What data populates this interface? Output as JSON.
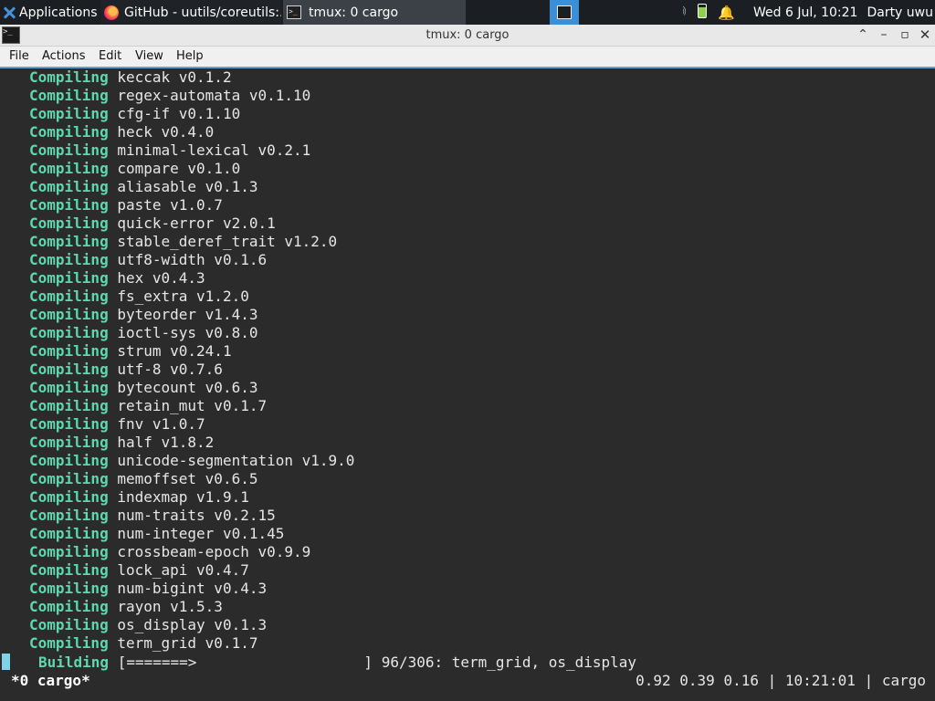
{
  "panel": {
    "applications_label": "Applications",
    "tasks": [
      {
        "title": "GitHub - uutils/coreutils:...",
        "icon": "firefox-icon"
      },
      {
        "title": "tmux: 0 cargo",
        "icon": "terminal-icon"
      }
    ],
    "tray": {
      "volume_icon": "🔊",
      "notification_icon": "🔔",
      "clock": "Wed  6 Jul, 10:21",
      "user": "Darty uwu"
    }
  },
  "window": {
    "title": "tmux: 0 cargo",
    "controls": {
      "shade": "⌃",
      "minimize": "–",
      "maximize": "▫",
      "close": "✕"
    }
  },
  "menubar": {
    "file": "File",
    "actions": "Actions",
    "edit": "Edit",
    "view": "View",
    "help": "Help"
  },
  "terminal": {
    "lines": [
      {
        "verb": "Compiling",
        "text": "keccak v0.1.2"
      },
      {
        "verb": "Compiling",
        "text": "regex-automata v0.1.10"
      },
      {
        "verb": "Compiling",
        "text": "cfg-if v0.1.10"
      },
      {
        "verb": "Compiling",
        "text": "heck v0.4.0"
      },
      {
        "verb": "Compiling",
        "text": "minimal-lexical v0.2.1"
      },
      {
        "verb": "Compiling",
        "text": "compare v0.1.0"
      },
      {
        "verb": "Compiling",
        "text": "aliasable v0.1.3"
      },
      {
        "verb": "Compiling",
        "text": "paste v1.0.7"
      },
      {
        "verb": "Compiling",
        "text": "quick-error v2.0.1"
      },
      {
        "verb": "Compiling",
        "text": "stable_deref_trait v1.2.0"
      },
      {
        "verb": "Compiling",
        "text": "utf8-width v0.1.6"
      },
      {
        "verb": "Compiling",
        "text": "hex v0.4.3"
      },
      {
        "verb": "Compiling",
        "text": "fs_extra v1.2.0"
      },
      {
        "verb": "Compiling",
        "text": "byteorder v1.4.3"
      },
      {
        "verb": "Compiling",
        "text": "ioctl-sys v0.8.0"
      },
      {
        "verb": "Compiling",
        "text": "strum v0.24.1"
      },
      {
        "verb": "Compiling",
        "text": "utf-8 v0.7.6"
      },
      {
        "verb": "Compiling",
        "text": "bytecount v0.6.3"
      },
      {
        "verb": "Compiling",
        "text": "retain_mut v0.1.7"
      },
      {
        "verb": "Compiling",
        "text": "fnv v1.0.7"
      },
      {
        "verb": "Compiling",
        "text": "half v1.8.2"
      },
      {
        "verb": "Compiling",
        "text": "unicode-segmentation v1.9.0"
      },
      {
        "verb": "Compiling",
        "text": "memoffset v0.6.5"
      },
      {
        "verb": "Compiling",
        "text": "indexmap v1.9.1"
      },
      {
        "verb": "Compiling",
        "text": "num-traits v0.2.15"
      },
      {
        "verb": "Compiling",
        "text": "num-integer v0.1.45"
      },
      {
        "verb": "Compiling",
        "text": "crossbeam-epoch v0.9.9"
      },
      {
        "verb": "Compiling",
        "text": "lock_api v0.4.7"
      },
      {
        "verb": "Compiling",
        "text": "num-bigint v0.4.3"
      },
      {
        "verb": "Compiling",
        "text": "rayon v1.5.3"
      },
      {
        "verb": "Compiling",
        "text": "os_display v0.1.3"
      },
      {
        "verb": "Compiling",
        "text": "term_grid v0.1.7"
      }
    ],
    "building": {
      "verb": "Building",
      "bar": "[=======>                   ] 96/306: term_grid, os_display"
    },
    "progress": {
      "done": 96,
      "total": 306
    },
    "status_left": "*0 cargo*",
    "status_right": "0.92 0.39 0.16 | 10:21:01 | cargo"
  },
  "colors": {
    "verb": "#5fd7af",
    "terminal_bg": "#2b2b2b",
    "accent": "#3b8fd6",
    "cursor": "#7fd3e6"
  }
}
